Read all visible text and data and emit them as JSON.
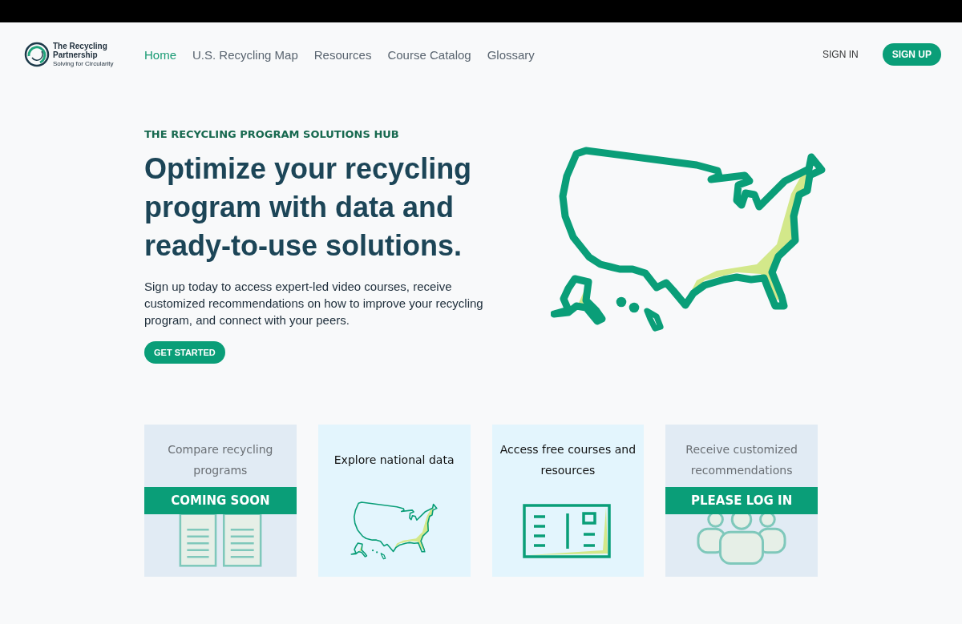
{
  "logo": {
    "name": "The Recycling Partnership",
    "tagline": "Solving for Circularity"
  },
  "nav": [
    {
      "label": "Home",
      "selected": true
    },
    {
      "label": "U.S. Recycling Map",
      "selected": false
    },
    {
      "label": "Resources",
      "selected": false
    },
    {
      "label": "Course Catalog",
      "selected": false
    },
    {
      "label": "Glossary",
      "selected": false
    }
  ],
  "sign_in": "SIGN IN",
  "sign_up": "SIGN UP",
  "hero": {
    "eyebrow": "THE RECYCLING PROGRAM SOLUTIONS HUB",
    "title": "Optimize your recycling program with data and ready-to-use solutions.",
    "body": "Sign up today to access expert-led video courses, receive customized recommendations on how to improve your recycling program, and connect with your peers.",
    "cta": "GET STARTED"
  },
  "cards": [
    {
      "title": "Compare recycling programs",
      "kind": "compare",
      "disabled": true,
      "banner": "COMING SOON"
    },
    {
      "title": "Explore national data",
      "kind": "map",
      "disabled": false
    },
    {
      "title": "Access free courses and resources",
      "kind": "course",
      "disabled": false
    },
    {
      "title": "Receive customized recommendations",
      "kind": "people",
      "disabled": true,
      "banner": "PLEASE LOG IN"
    }
  ]
}
